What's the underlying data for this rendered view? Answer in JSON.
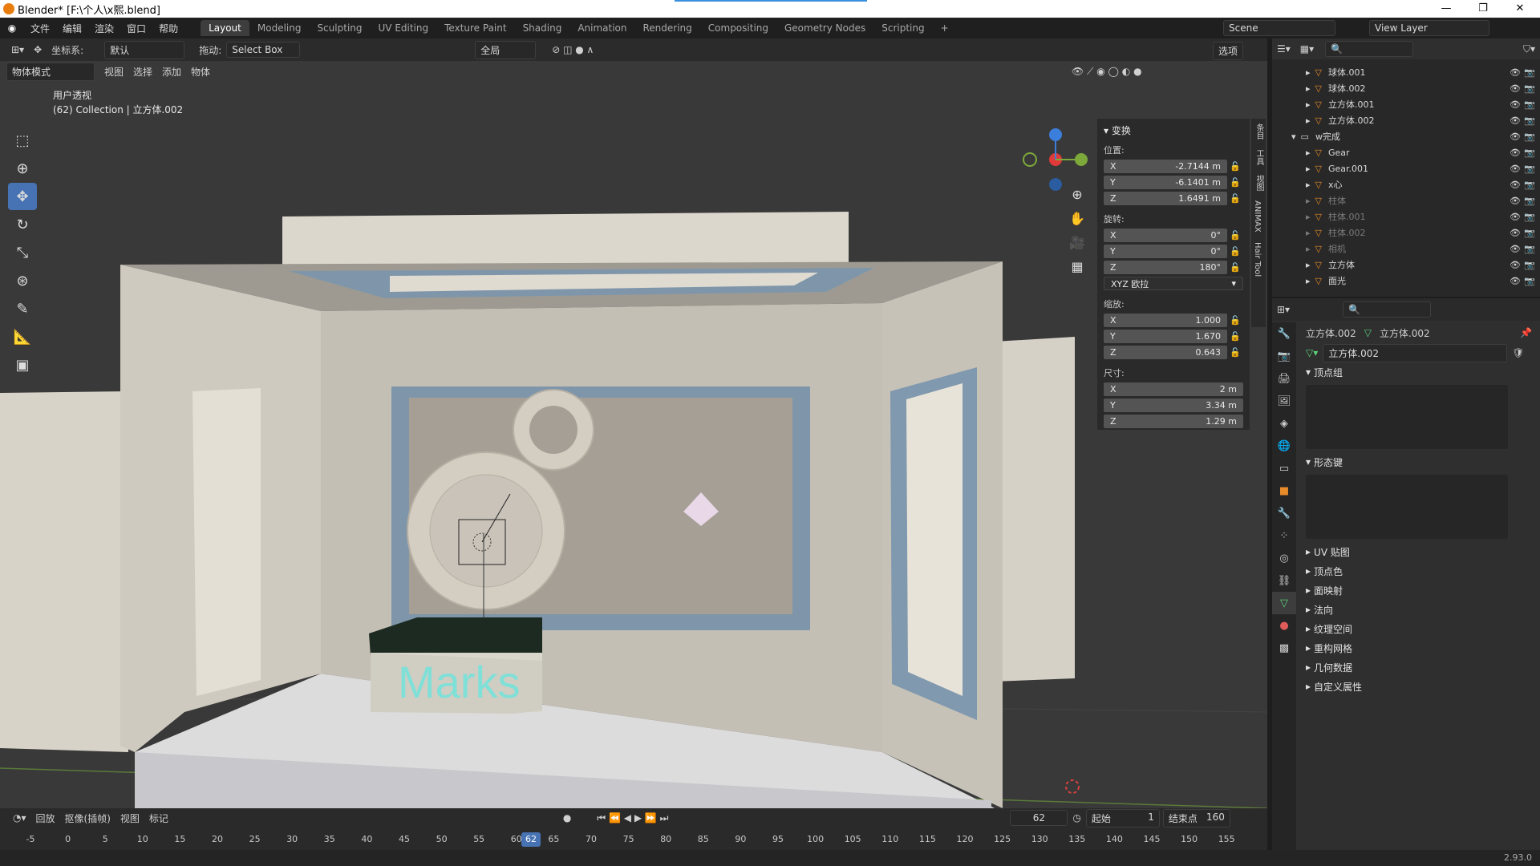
{
  "window": {
    "title": "Blender* [F:\\个人\\x熙.blend]"
  },
  "menus": [
    "文件",
    "编辑",
    "渲染",
    "窗口",
    "帮助"
  ],
  "workspaces": [
    "Layout",
    "Modeling",
    "Sculpting",
    "UV Editing",
    "Texture Paint",
    "Shading",
    "Animation",
    "Rendering",
    "Compositing",
    "Geometry Nodes",
    "Scripting"
  ],
  "active_workspace": "Layout",
  "scene": {
    "name": "Scene",
    "view_layer": "View Layer"
  },
  "vp_header": {
    "coord_label": "坐标系:",
    "coord_value": "默认",
    "drag_label": "拖动:",
    "drag_value": "Select Box",
    "transform_orient": "全局",
    "options": "选项"
  },
  "vp_header2": {
    "mode": "物体模式",
    "items": [
      "视图",
      "选择",
      "添加",
      "物体"
    ]
  },
  "viewport_info": {
    "view": "用户透视",
    "collection": "(62) Collection | 立方体.002"
  },
  "scene_text": "Marks",
  "npanel": {
    "section": "变换",
    "location_label": "位置:",
    "location": [
      {
        "axis": "X",
        "value": "-2.7144 m"
      },
      {
        "axis": "Y",
        "value": "-6.1401 m"
      },
      {
        "axis": "Z",
        "value": "1.6491 m"
      }
    ],
    "rotation_label": "旋转:",
    "rotation": [
      {
        "axis": "X",
        "value": "0°"
      },
      {
        "axis": "Y",
        "value": "0°"
      },
      {
        "axis": "Z",
        "value": "180°"
      }
    ],
    "rotation_mode": "XYZ 欧拉",
    "scale_label": "缩放:",
    "scale": [
      {
        "axis": "X",
        "value": "1.000"
      },
      {
        "axis": "Y",
        "value": "1.670"
      },
      {
        "axis": "Z",
        "value": "0.643"
      }
    ],
    "dims_label": "尺寸:",
    "dims": [
      {
        "axis": "X",
        "value": "2 m"
      },
      {
        "axis": "Y",
        "value": "3.34 m"
      },
      {
        "axis": "Z",
        "value": "1.29 m"
      }
    ],
    "side_tabs": [
      "条目",
      "工具",
      "视图",
      "ANIMAX",
      "Hair Tool"
    ]
  },
  "outliner": {
    "rows": [
      {
        "name": "球体.001",
        "dim": false,
        "indent": 2
      },
      {
        "name": "球体.002",
        "dim": false,
        "indent": 2
      },
      {
        "name": "立方体.001",
        "dim": false,
        "indent": 2
      },
      {
        "name": "立方体.002",
        "dim": false,
        "indent": 2
      },
      {
        "name": "w完成",
        "dim": false,
        "indent": 1
      },
      {
        "name": "Gear",
        "dim": false,
        "indent": 2
      },
      {
        "name": "Gear.001",
        "dim": false,
        "indent": 2
      },
      {
        "name": "x心",
        "dim": false,
        "indent": 2
      },
      {
        "name": "柱体",
        "dim": true,
        "indent": 2
      },
      {
        "name": "柱体.001",
        "dim": true,
        "indent": 2
      },
      {
        "name": "柱体.002",
        "dim": true,
        "indent": 2
      },
      {
        "name": "相机",
        "dim": true,
        "indent": 2
      },
      {
        "name": "立方体",
        "dim": false,
        "indent": 2
      },
      {
        "name": "面光",
        "dim": false,
        "indent": 2
      }
    ]
  },
  "properties": {
    "object": "立方体.002",
    "mesh": "立方体.002",
    "data_name": "立方体.002",
    "sections": [
      "顶点组",
      "形态键"
    ],
    "collapsed": [
      "UV 贴图",
      "顶点色",
      "面映射",
      "法向",
      "纹理空间",
      "重构网格",
      "几何数据",
      "自定义属性"
    ]
  },
  "timeline": {
    "menu": [
      "回放",
      "抠像(插帧)",
      "视图",
      "标记"
    ],
    "current_frame": "62",
    "start_label": "起始",
    "start": "1",
    "end_label": "结束点",
    "end": "160",
    "ticks": [
      "-5",
      "0",
      "5",
      "10",
      "15",
      "20",
      "25",
      "30",
      "35",
      "40",
      "45",
      "50",
      "55",
      "60",
      "65",
      "70",
      "75",
      "80",
      "85",
      "90",
      "95",
      "100",
      "105",
      "110",
      "115",
      "120",
      "125",
      "130",
      "135",
      "140",
      "145",
      "150",
      "155"
    ]
  },
  "version": "2.93.0"
}
